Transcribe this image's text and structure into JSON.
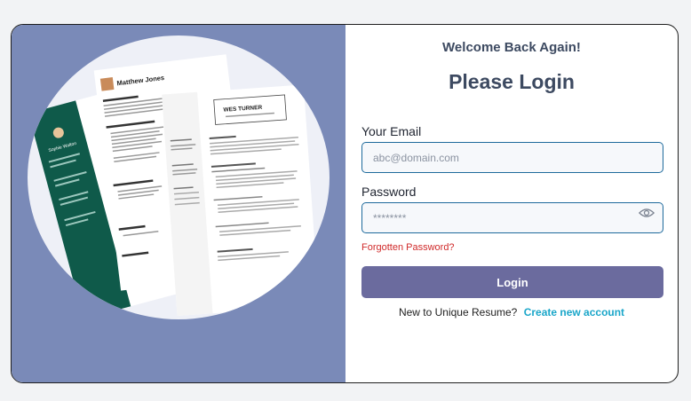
{
  "colors": {
    "panel_bg": "#7a8ab8",
    "accent": "#6b6b9e",
    "link": "#1aa6c9",
    "error": "#d02a2a",
    "input_border": "#1e6a9c"
  },
  "illustration": {
    "resume1_name": "Matthew Jones",
    "resume2_name": "Sophie Walton",
    "resume3_name": "WES TURNER"
  },
  "login": {
    "welcome": "Welcome Back Again!",
    "title": "Please Login",
    "email_label": "Your Email",
    "email_placeholder": "abc@domain.com",
    "email_value": "",
    "password_label": "Password",
    "password_placeholder": "********",
    "password_value": "",
    "forgot_link": "Forgotten Password?",
    "button": "Login",
    "signup_prompt": "New to Unique Resume?",
    "signup_link": "Create new account",
    "eye_icon": "eye-icon"
  }
}
